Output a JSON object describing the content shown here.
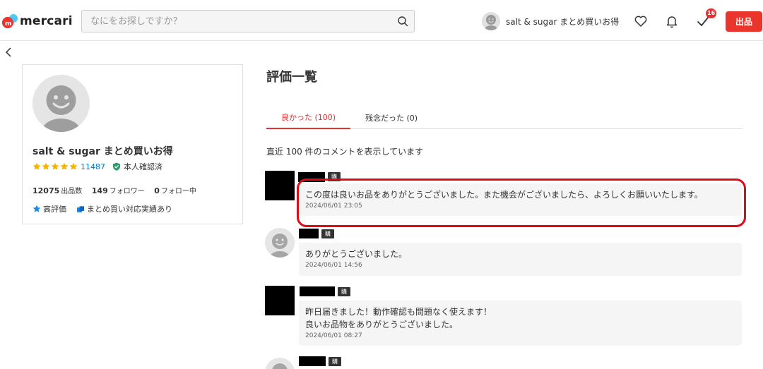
{
  "header": {
    "logo_text": "mercari",
    "search_placeholder": "なにをお探しですか？",
    "user_name": "salt & sugar まとめ買いお得",
    "notification_badge": "16",
    "sell_label": "出品"
  },
  "profile": {
    "name": "salt & sugar まとめ買いお得",
    "rating_stars": 5,
    "rating_count": "11487",
    "verified_label": "本人確認済",
    "listings_count": "12075",
    "listings_label": "出品数",
    "followers_count": "149",
    "followers_label": "フォロワー",
    "following_count": "0",
    "following_label": "フォロー中",
    "tags": [
      "高評価",
      "まとめ買い対応実績あり"
    ]
  },
  "main": {
    "title": "評価一覧",
    "tabs": [
      {
        "label": "良かった (100)",
        "active": true
      },
      {
        "label": "残念だった (0)",
        "active": false
      }
    ],
    "count_note": "直近 100 件のコメントを表示しています",
    "reviews": [
      {
        "badge": "購入者",
        "lines": [
          "この度は良いお品をありがとうございました。また機会がございましたら、よろしくお願いいたします。"
        ],
        "date": "2024/06/01 23:05"
      },
      {
        "badge": "購入者",
        "lines": [
          "ありがとうございました。"
        ],
        "date": "2024/06/01 14:56"
      },
      {
        "badge": "購入者",
        "lines": [
          "昨日届きました！動作確認も問題なく使えます！",
          "良いお品物をありがとうございました。"
        ],
        "date": "2024/06/01 08:27"
      },
      {
        "badge": "購入者"
      }
    ]
  },
  "colors": {
    "brand_red": "#ea352d",
    "active_tab": "#e73030",
    "link_blue": "#0073cc",
    "star": "#f5b300",
    "highlight": "#e00a14"
  }
}
